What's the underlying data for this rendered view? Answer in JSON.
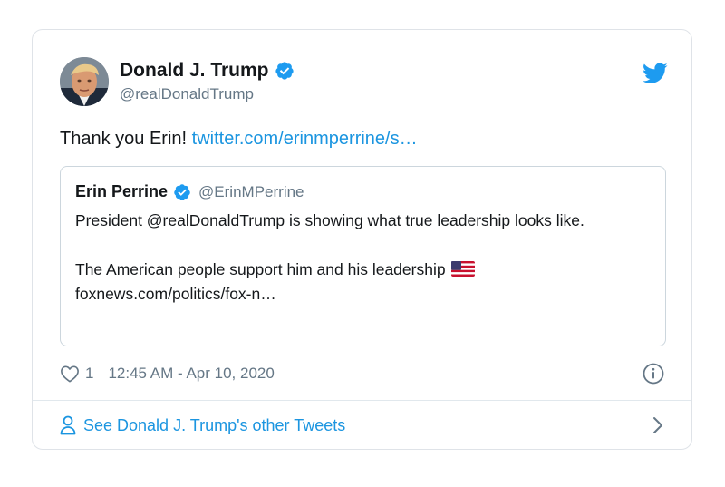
{
  "tweet": {
    "author": {
      "display_name": "Donald J. Trump",
      "handle": "@realDonaldTrump",
      "verified": true
    },
    "text": "Thank you Erin!",
    "link_text": "twitter.com/erinmperrine/s…",
    "quoted": {
      "display_name": "Erin Perrine",
      "handle": "@ErinMPerrine",
      "verified": true,
      "line1": "President  @realDonaldTrump is showing what true leadership looks like.",
      "line2": "The American people support him and his leadership",
      "line3": "foxnews.com/politics/fox-n…"
    },
    "like_count": "1",
    "timestamp": "12:45 AM - Apr 10, 2020",
    "footer_link": "See Donald J. Trump's other Tweets"
  },
  "icons": {
    "brand": "twitter-bird-icon",
    "verified": "verified-badge-icon",
    "like": "heart-icon",
    "info": "info-icon",
    "profile": "person-icon",
    "chevron": "chevron-right-icon",
    "flag": "us-flag-icon"
  },
  "colors": {
    "twitter_blue": "#1d9bf0",
    "link_blue": "#1b95e0",
    "text": "#14171a",
    "muted": "#657786",
    "border": "#dfe3e8"
  }
}
